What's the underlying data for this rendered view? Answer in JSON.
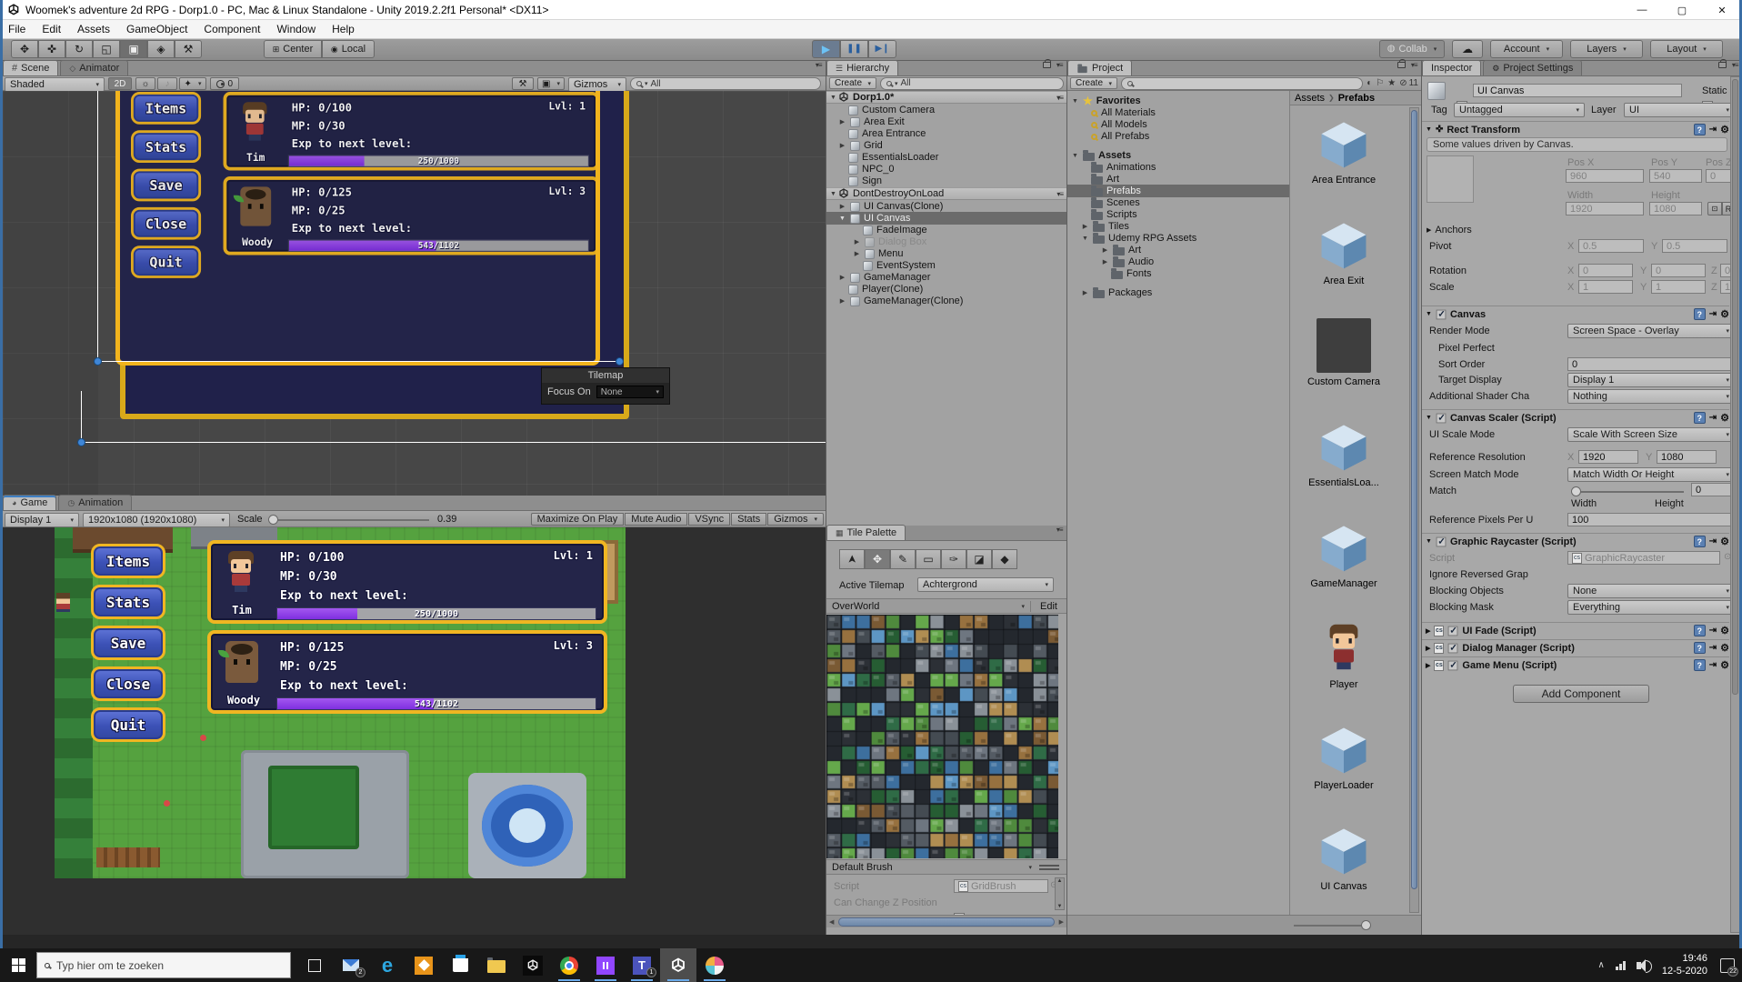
{
  "window": {
    "title": "Woomek's adventure 2d RPG - Dorp1.0 - PC, Mac & Linux Standalone - Unity 2019.2.2f1 Personal* <DX11>"
  },
  "menu": {
    "items": [
      "File",
      "Edit",
      "Assets",
      "GameObject",
      "Component",
      "Window",
      "Help"
    ]
  },
  "toolbar": {
    "center": "Center",
    "local": "Local",
    "collab": "Collab",
    "account": "Account",
    "layers": "Layers",
    "layout": "Layout"
  },
  "scene": {
    "tab": "Scene",
    "tab2": "Animator",
    "shaded": "Shaded",
    "mode2d": "2D",
    "eye_count": "0",
    "gizmos": "Gizmos",
    "search": "All",
    "tilemap_overlay": {
      "title": "Tilemap",
      "focus": "Focus On",
      "value": "None"
    }
  },
  "game": {
    "tab": "Game",
    "tab2": "Animation",
    "display": "Display 1",
    "resolution": "1920x1080 (1920x1080)",
    "scale_label": "Scale",
    "scale_value": "0.39",
    "maximize": "Maximize On Play",
    "mute": "Mute Audio",
    "vsync": "VSync",
    "stats": "Stats",
    "gizmos": "Gizmos"
  },
  "game_ui": {
    "buttons": [
      "Items",
      "Stats",
      "Save",
      "Close",
      "Quit"
    ],
    "party": [
      {
        "name": "Tim",
        "level": "Lvl: 1",
        "hp": "HP: 0/100",
        "mp": "MP: 0/30",
        "exp_label": "Exp to next level:",
        "exp_text": "250/1000",
        "exp_pct": 25
      },
      {
        "name": "Woody",
        "level": "Lvl: 3",
        "hp": "HP: 0/125",
        "mp": "MP: 0/25",
        "exp_label": "Exp to next level:",
        "exp_text": "543/1102",
        "exp_pct": 49
      }
    ]
  },
  "hierarchy": {
    "tab": "Hierarchy",
    "create": "Create",
    "search": "All",
    "items": [
      "Dorp1.0*",
      "Custom Camera",
      "Area Exit",
      "Area Entrance",
      "Grid",
      "EssentialsLoader",
      "NPC_0",
      "Sign",
      "DontDestroyOnLoad",
      "UI Canvas(Clone)",
      "UI Canvas",
      "FadeImage",
      "Dialog Box",
      "Menu",
      "EventSystem",
      "GameManager",
      "Player(Clone)",
      "GameManager(Clone)"
    ]
  },
  "tile_palette": {
    "tab": "Tile Palette",
    "active_label": "Active Tilemap",
    "active_value": "Achtergrond",
    "palette": "OverWorld",
    "edit": "Edit",
    "brush": "Default Brush",
    "script_label": "Script",
    "script_value": "GridBrush",
    "z_label": "Can Change Z Position"
  },
  "project": {
    "tab": "Project",
    "create": "Create",
    "hidden_count": "11",
    "tree": {
      "favorites": "Favorites",
      "all_materials": "All Materials",
      "all_models": "All Models",
      "all_prefabs": "All Prefabs",
      "assets": "Assets",
      "animations": "Animations",
      "art": "Art",
      "prefabs": "Prefabs",
      "scenes": "Scenes",
      "scripts": "Scripts",
      "tiles": "Tiles",
      "udemy": "Udemy RPG Assets",
      "udemy_art": "Art",
      "udemy_audio": "Audio",
      "udemy_fonts": "Fonts",
      "packages": "Packages"
    },
    "breadcrumb": {
      "root": "Assets",
      "current": "Prefabs"
    },
    "prefabs": [
      "Area Entrance",
      "Area Exit",
      "Custom Camera",
      "EssentialsLoa...",
      "GameManager",
      "Player",
      "PlayerLoader",
      "UI Canvas"
    ]
  },
  "inspector": {
    "tab": "Inspector",
    "tab2": "Project Settings",
    "name": "UI Canvas",
    "static": "Static",
    "tag_label": "Tag",
    "tag": "Untagged",
    "layer_label": "Layer",
    "layer": "UI",
    "axis": {
      "x": "X",
      "y": "Y",
      "z": "Z"
    },
    "rect": {
      "title": "Rect Transform",
      "info": "Some values driven by Canvas.",
      "posx_l": "Pos X",
      "posx": "960",
      "posy_l": "Pos Y",
      "posy": "540",
      "posz_l": "Pos Z",
      "posz": "0",
      "w_l": "Width",
      "w": "1920",
      "h_l": "Height",
      "h": "1080",
      "r": "R",
      "anchors": "Anchors",
      "pivot": "Pivot",
      "pivot_x": "0.5",
      "pivot_y": "0.5",
      "rotation": "Rotation",
      "rx": "0",
      "ry": "0",
      "rz": "0",
      "scale": "Scale",
      "sx": "1",
      "sy": "1",
      "sz": "1"
    },
    "canvas": {
      "title": "Canvas",
      "render_l": "Render Mode",
      "render": "Screen Space - Overlay",
      "pixel_l": "Pixel Perfect",
      "sort_l": "Sort Order",
      "sort": "0",
      "target_l": "Target Display",
      "target": "Display 1",
      "shader_l": "Additional Shader Cha",
      "shader": "Nothing"
    },
    "scaler": {
      "title": "Canvas Scaler (Script)",
      "mode_l": "UI Scale Mode",
      "mode": "Scale With Screen Size",
      "res_l": "Reference Resolution",
      "resx": "1920",
      "resy": "1080",
      "match_mode_l": "Screen Match Mode",
      "match_mode": "Match Width Or Height",
      "match_l": "Match",
      "match": "0",
      "width": "Width",
      "height": "Height",
      "ppu_l": "Reference Pixels Per U",
      "ppu": "100"
    },
    "raycaster": {
      "title": "Graphic Raycaster (Script)",
      "script_l": "Script",
      "script": "GraphicRaycaster",
      "ignore_l": "Ignore Reversed Grap",
      "objects_l": "Blocking Objects",
      "objects": "None",
      "mask_l": "Blocking Mask",
      "mask": "Everything"
    },
    "extra": [
      "UI Fade (Script)",
      "Dialog Manager (Script)",
      "Game Menu (Script)"
    ],
    "add_component": "Add Component"
  },
  "taskbar": {
    "search": "Typ hier om te zoeken",
    "time": "19:46",
    "date": "12-5-2020",
    "mail_badge": "2",
    "teams_badge": "1",
    "notif_badge": "22"
  }
}
